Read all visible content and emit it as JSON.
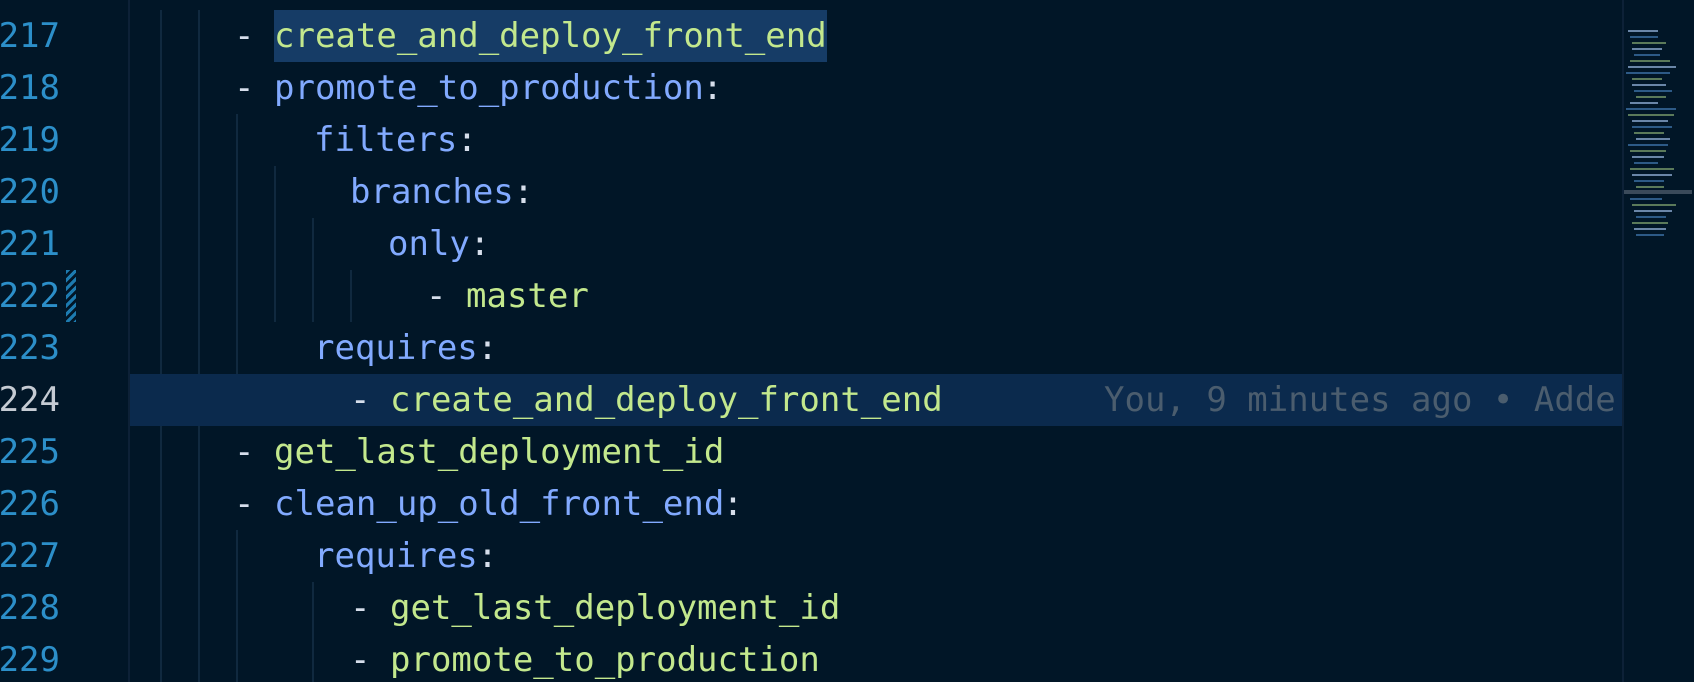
{
  "editor": {
    "blame_annotation": "You, 9 minutes ago • Adde",
    "colors": {
      "background": "#011627",
      "line_number": "#2c8fc9",
      "line_number_active": "#c5cbd3",
      "key": "#82aaff",
      "value": "#c3e88d",
      "current_line": "#0b2a4d",
      "selection_highlight": "#163c66",
      "active_indent_guide": "#c792ea"
    }
  },
  "gutter": {
    "line_numbers": [
      "217",
      "218",
      "219",
      "220",
      "221",
      "222",
      "223",
      "224",
      "225",
      "226",
      "227",
      "228",
      "229"
    ],
    "active_line": "224"
  },
  "lines": [
    {
      "number": "217",
      "dash": "-",
      "text": "create_and_deploy_front_end",
      "kind": "value",
      "colon": "",
      "highlight": true
    },
    {
      "number": "218",
      "dash": "-",
      "text": "promote_to_production",
      "kind": "key",
      "colon": ":"
    },
    {
      "number": "219",
      "dash": "",
      "text": "filters",
      "kind": "key",
      "colon": ":"
    },
    {
      "number": "220",
      "dash": "",
      "text": "branches",
      "kind": "key",
      "colon": ":"
    },
    {
      "number": "221",
      "dash": "",
      "text": "only",
      "kind": "key",
      "colon": ":"
    },
    {
      "number": "222",
      "dash": "-",
      "text": "master",
      "kind": "value",
      "colon": ""
    },
    {
      "number": "223",
      "dash": "",
      "text": "requires",
      "kind": "key",
      "colon": ":"
    },
    {
      "number": "224",
      "dash": "-",
      "text": "create_and_deploy_front_end",
      "kind": "value",
      "colon": "",
      "current": true
    },
    {
      "number": "225",
      "dash": "-",
      "text": "get_last_deployment_id",
      "kind": "value",
      "colon": ""
    },
    {
      "number": "226",
      "dash": "-",
      "text": "clean_up_old_front_end",
      "kind": "key",
      "colon": ":"
    },
    {
      "number": "227",
      "dash": "",
      "text": "requires",
      "kind": "key",
      "colon": ":"
    },
    {
      "number": "228",
      "dash": "-",
      "text": "get_last_deployment_id",
      "kind": "value",
      "colon": ""
    },
    {
      "number": "229",
      "dash": "-",
      "text": "promote_to_production",
      "kind": "value",
      "colon": ""
    }
  ]
}
